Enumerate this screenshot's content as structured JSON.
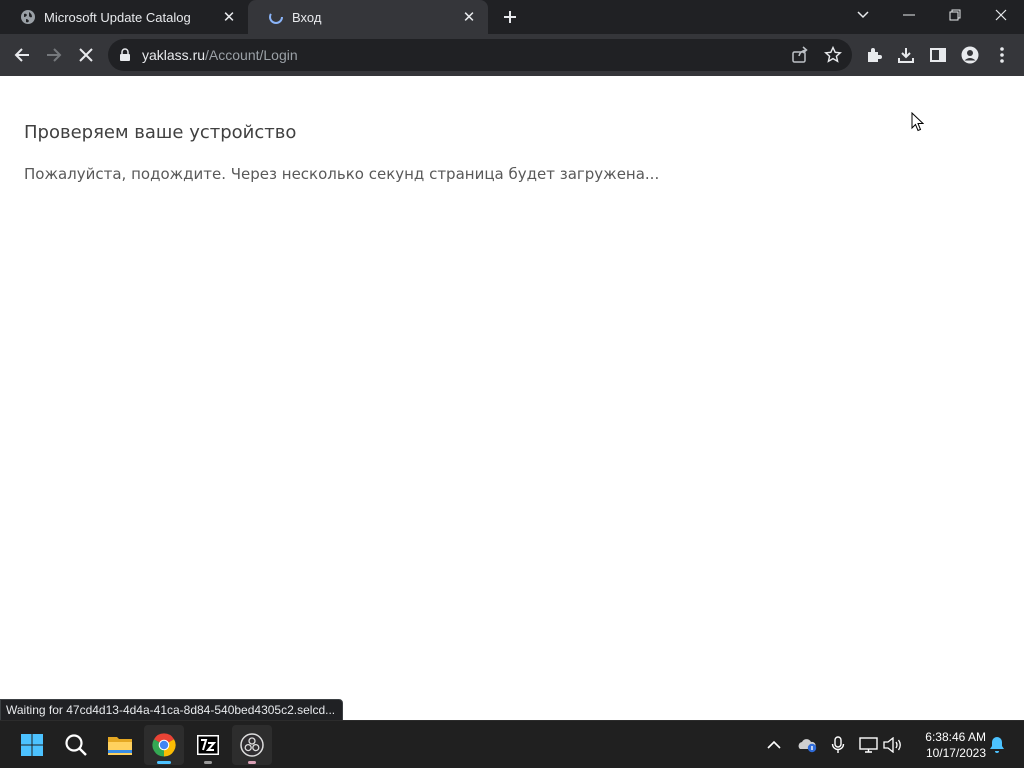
{
  "browser": {
    "tabs": [
      {
        "title": "Microsoft Update Catalog",
        "favicon": "globe-icon",
        "active": false
      },
      {
        "title": "Вход",
        "favicon": "page-loading-icon",
        "active": true
      }
    ],
    "address": {
      "host": "yaklass.ru",
      "path": "/Account/Login"
    }
  },
  "page": {
    "heading": "Проверяем ваше устройство",
    "message": "Пожалуйста, подождите. Через несколько секунд страница будет загружена..."
  },
  "status_bar": {
    "text": "Waiting for 47cd4d13-4d4a-41ca-8d84-540bed4305c2.selcd..."
  },
  "taskbar": {
    "apps": [
      "windows-start-icon",
      "search-icon",
      "file-explorer-icon",
      "chrome-icon",
      "7zip-icon",
      "obs-icon"
    ],
    "time": "6:38:46 AM",
    "date": "10/17/2023"
  },
  "colors": {
    "tab_strip": "#202124",
    "toolbar": "#35363a",
    "taskbar": "#202020",
    "accent": "#4cc2ff"
  }
}
